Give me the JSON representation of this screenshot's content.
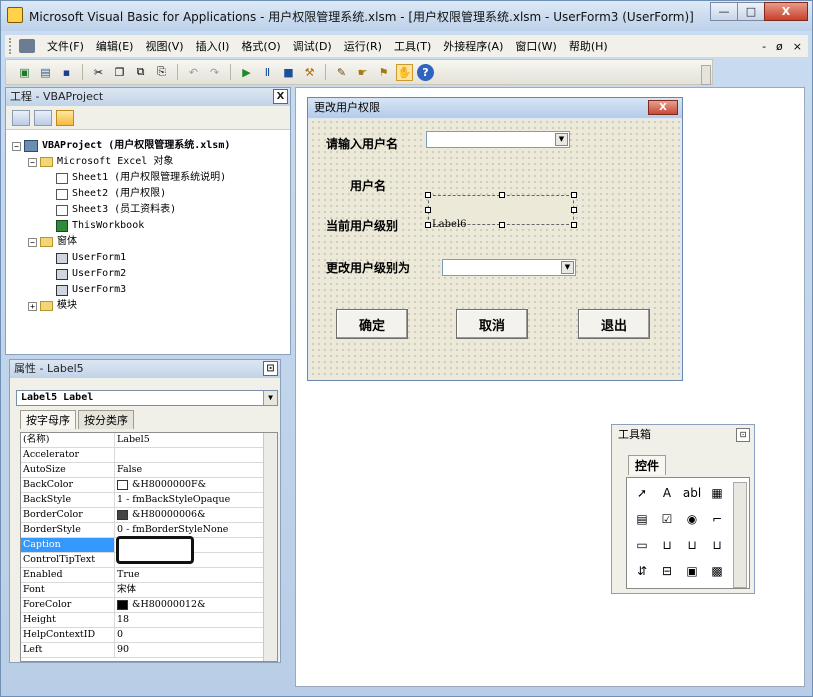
{
  "window": {
    "title": "Microsoft Visual Basic for Applications - 用户权限管理系统.xlsm - [用户权限管理系统.xlsm - UserForm3 (UserForm)]",
    "min": "—",
    "max": "□",
    "close": "X"
  },
  "menu": {
    "items": [
      "文件(F)",
      "编辑(E)",
      "视图(V)",
      "插入(I)",
      "格式(O)",
      "调试(D)",
      "运行(R)",
      "工具(T)",
      "外接程序(A)",
      "窗口(W)",
      "帮助(H)"
    ],
    "right": [
      "-",
      "ø",
      "×"
    ]
  },
  "toolbar": {
    "icons": [
      "▣",
      "▤",
      "▪",
      "✂",
      "❐",
      "⧉",
      "⎘",
      "↶",
      "↷",
      "▶",
      "Ⅱ",
      "■",
      "⚒",
      "✎",
      "☛",
      "⚑",
      "✋",
      "?"
    ]
  },
  "project": {
    "title": "工程 - VBAProject",
    "close": "X",
    "root": "VBAProject (用户权限管理系统.xlsm)",
    "excel_objects": "Microsoft Excel 对象",
    "sheets": [
      "Sheet1 (用户权限管理系统说明)",
      "Sheet2 (用户权限)",
      "Sheet3 (员工资料表)"
    ],
    "workbook": "ThisWorkbook",
    "forms_folder": "窗体",
    "forms": [
      "UserForm1",
      "UserForm2",
      "UserForm3"
    ],
    "modules_folder": "模块"
  },
  "properties": {
    "title": "属性 - Label5",
    "close": "⊡",
    "object": "Label5 Label",
    "tab_alpha": "按字母序",
    "tab_category": "按分类序",
    "rows": [
      {
        "name": "(名称)",
        "value": "Label5"
      },
      {
        "name": "Accelerator",
        "value": ""
      },
      {
        "name": "AutoSize",
        "value": "False"
      },
      {
        "name": "BackColor",
        "value": "&H8000000F&",
        "swatch": "#ffffff"
      },
      {
        "name": "BackStyle",
        "value": "1 - fmBackStyleOpaque"
      },
      {
        "name": "BorderColor",
        "value": "&H80000006&",
        "swatch": "#444444"
      },
      {
        "name": "BorderStyle",
        "value": "0 - fmBorderStyleNone"
      },
      {
        "name": "Caption",
        "value": ""
      },
      {
        "name": "ControlTipText",
        "value": ""
      },
      {
        "name": "Enabled",
        "value": "True"
      },
      {
        "name": "Font",
        "value": "宋体"
      },
      {
        "name": "ForeColor",
        "value": "&H80000012&",
        "swatch": "#000000"
      },
      {
        "name": "Height",
        "value": "18"
      },
      {
        "name": "HelpContextID",
        "value": "0"
      },
      {
        "name": "Left",
        "value": "90"
      }
    ]
  },
  "userform": {
    "title": "更改用户权限",
    "close": "X",
    "label_input_user": "请输入用户名",
    "label_user": "用户名",
    "label_current_level": "当前用户级别",
    "label6": "Label6",
    "label_change_level": "更改用户级别为",
    "btn_ok": "确定",
    "btn_cancel": "取消",
    "btn_exit": "退出"
  },
  "toolbox": {
    "title": "工具箱",
    "close": "⊡",
    "tab": "控件",
    "tools": [
      "➚",
      "A",
      "abl",
      "▦",
      "▤",
      "☑",
      "◉",
      "⌐",
      "▭",
      "⊔",
      "⊔",
      "⊔",
      "⇵",
      "⊟",
      "▣",
      "▩"
    ]
  },
  "colors": {
    "accent": "#3399ff",
    "titlebar": "#bcd1ea",
    "form_bg": "#ece9d8"
  }
}
